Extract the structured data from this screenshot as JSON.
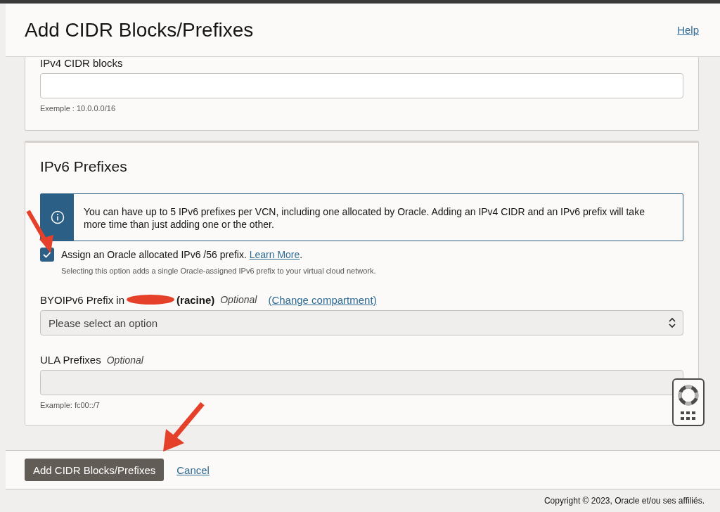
{
  "dialog": {
    "title": "Add CIDR Blocks/Prefixes",
    "help_link": "Help"
  },
  "ipv4": {
    "label": "IPv4 CIDR blocks",
    "hint": "Exemple : 10.0.0.0/16"
  },
  "ipv6": {
    "title": "IPv6 Prefixes",
    "info": "You can have up to 5 IPv6 prefixes per VCN, including one allocated by Oracle. Adding an IPv4 CIDR and an IPv6 prefix will take more time than just adding one or the other.",
    "assign": {
      "label": "Assign an Oracle allocated IPv6 /56 prefix.",
      "link": "Learn More",
      "end": ".",
      "checked": true,
      "hint": "Selecting this option adds a single Oracle-assigned IPv6 prefix to your virtual cloud network."
    },
    "byoip": {
      "label": "BYOIPv6 Prefix in",
      "compartment": "(racine)",
      "optional": "Optional",
      "link": "(Change compartment)",
      "placeholder": "Please select an option"
    },
    "ula": {
      "label": "ULA Prefixes",
      "optional": "Optional",
      "hint": "Example: fc00::/7"
    }
  },
  "footer": {
    "buttons": [
      "Add CIDR Blocks/Prefixes"
    ],
    "cancel": "Cancel"
  },
  "copyright": "Copyright © 2023, Oracle et/ou ses affiliés."
}
